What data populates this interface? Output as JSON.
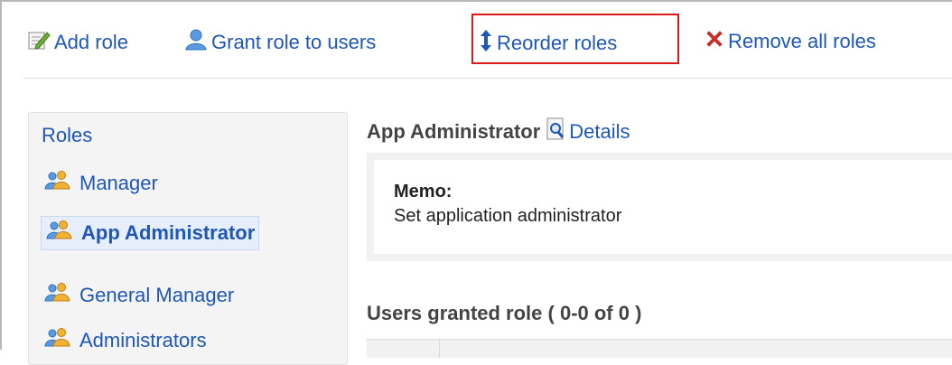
{
  "toolbar": {
    "add_role": "Add role",
    "grant_role": "Grant role to users",
    "reorder_roles": "Reorder roles",
    "remove_all_roles": "Remove all roles"
  },
  "icons": {
    "add_role": "edit-note-icon",
    "grant_role": "user-icon",
    "reorder_roles": "up-down-arrow-icon",
    "remove_all_roles": "red-x-icon",
    "role": "users-group-icon",
    "details": "magnifier-document-icon"
  },
  "colors": {
    "link": "#1e57b8",
    "highlight": "#e01818",
    "selected_bg": "#e6eef9"
  },
  "roles_panel": {
    "heading": "Roles",
    "items": [
      {
        "label": "Manager",
        "selected": false
      },
      {
        "label": "App Administrator",
        "selected": true
      },
      {
        "label": "General Manager",
        "selected": false
      },
      {
        "label": "Administrators",
        "selected": false
      }
    ]
  },
  "main": {
    "role_title": "App Administrator",
    "details_label": "Details",
    "memo_label": "Memo:",
    "memo_text": "Set application administrator",
    "users_heading": "Users granted role ( 0-0 of 0 )"
  }
}
